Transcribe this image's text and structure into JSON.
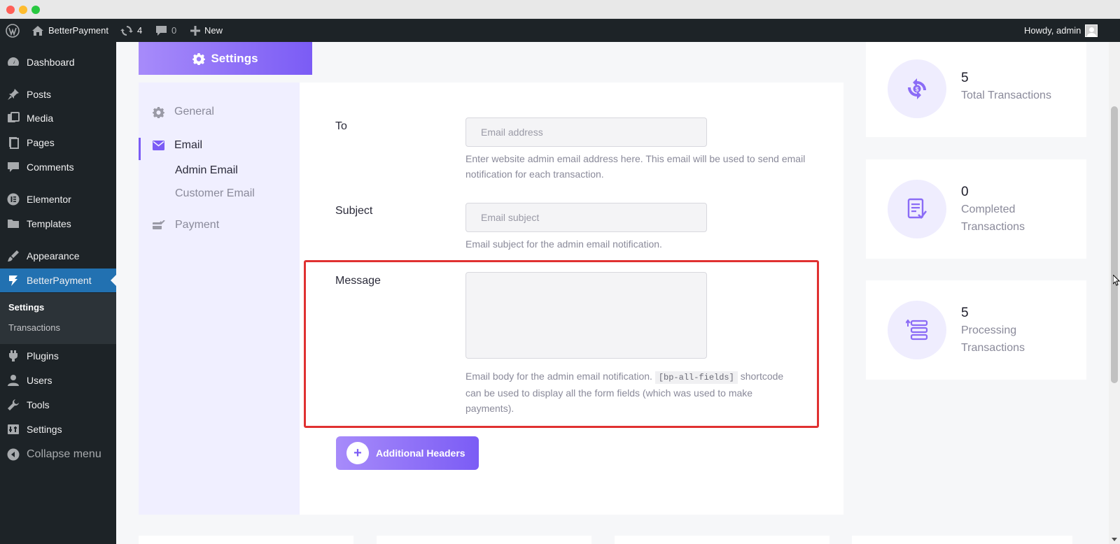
{
  "adminbar": {
    "site_name": "BetterPayment",
    "updates_count": "4",
    "comments_count": "0",
    "new_label": "New",
    "howdy": "Howdy, admin"
  },
  "sidebar": {
    "items": [
      {
        "label": "Dashboard",
        "icon": "dashboard-icon"
      },
      {
        "label": "Posts",
        "icon": "pin-icon"
      },
      {
        "label": "Media",
        "icon": "media-icon"
      },
      {
        "label": "Pages",
        "icon": "pages-icon"
      },
      {
        "label": "Comments",
        "icon": "comment-icon"
      },
      {
        "label": "Elementor",
        "icon": "elementor-icon"
      },
      {
        "label": "Templates",
        "icon": "folder-icon"
      },
      {
        "label": "Appearance",
        "icon": "brush-icon"
      },
      {
        "label": "BetterPayment",
        "icon": "betterpayment-icon"
      },
      {
        "label": "Plugins",
        "icon": "plugin-icon"
      },
      {
        "label": "Users",
        "icon": "user-icon"
      },
      {
        "label": "Tools",
        "icon": "wrench-icon"
      },
      {
        "label": "Settings",
        "icon": "settings-icon"
      },
      {
        "label": "Collapse menu",
        "icon": "collapse-icon"
      }
    ],
    "submenu": [
      "Settings",
      "Transactions"
    ]
  },
  "settings": {
    "tab_label": "Settings",
    "nav": {
      "general": "General",
      "email": "Email",
      "admin_email": "Admin Email",
      "customer_email": "Customer Email",
      "payment": "Payment"
    },
    "fields": {
      "to": {
        "label": "To",
        "placeholder": "Email address",
        "help": "Enter website admin email address here. This email will be used to send email notification for each transaction."
      },
      "subject": {
        "label": "Subject",
        "placeholder": "Email subject",
        "help": "Email subject for the admin email notification."
      },
      "message": {
        "label": "Message",
        "help_before": "Email body for the admin email notification.",
        "shortcode": "[bp-all-fields]",
        "help_after": "shortcode can be used to display all the form fields (which was used to make payments)."
      }
    },
    "additional_headers": "Additional Headers"
  },
  "stats": [
    {
      "value": "5",
      "label": "Total Transactions",
      "icon": "refresh-dollar-icon"
    },
    {
      "value": "0",
      "label": "Completed Transactions",
      "icon": "checklist-icon"
    },
    {
      "value": "5",
      "label": "Processing Transactions",
      "icon": "processing-icon"
    }
  ],
  "colors": {
    "accent": "#7b5cf5",
    "accent_light": "#a78bfa",
    "wp_dark": "#1d2327",
    "wp_blue": "#2271b1",
    "highlight": "#e03131"
  }
}
